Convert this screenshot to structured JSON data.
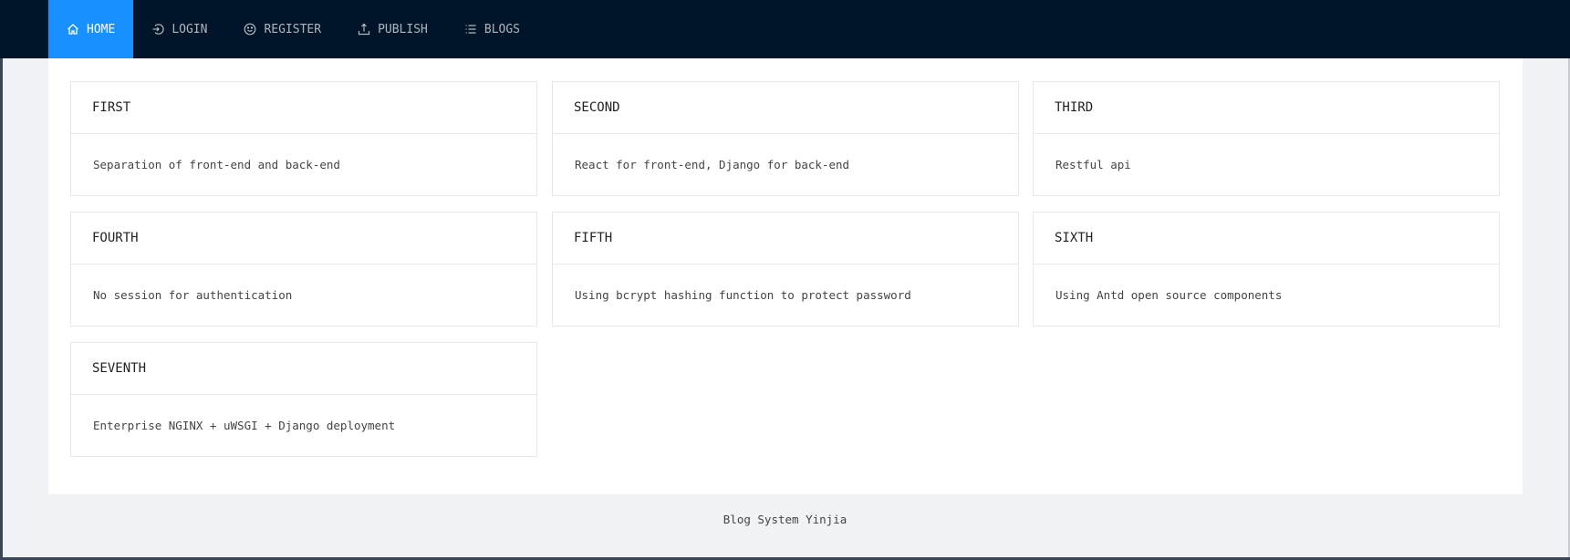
{
  "nav": {
    "items": [
      {
        "label": "HOME",
        "icon": "home-icon",
        "active": true
      },
      {
        "label": "LOGIN",
        "icon": "login-icon",
        "active": false
      },
      {
        "label": "REGISTER",
        "icon": "smile-icon",
        "active": false
      },
      {
        "label": "PUBLISH",
        "icon": "upload-icon",
        "active": false
      },
      {
        "label": "BLOGS",
        "icon": "list-icon",
        "active": false
      }
    ]
  },
  "cards": [
    {
      "title": "FIRST",
      "text": "Separation of front-end and back-end"
    },
    {
      "title": "SECOND",
      "text": "React for front-end, Django for back-end"
    },
    {
      "title": "THIRD",
      "text": "Restful api"
    },
    {
      "title": "FOURTH",
      "text": "No session for authentication"
    },
    {
      "title": "FIFTH",
      "text": "Using bcrypt hashing function to protect password"
    },
    {
      "title": "SIXTH",
      "text": "Using Antd open source components"
    },
    {
      "title": "SEVENTH",
      "text": "Enterprise NGINX + uWSGI + Django deployment"
    }
  ],
  "footer": {
    "text": "Blog System Yinjia"
  },
  "colors": {
    "header_bg": "#001529",
    "active_bg": "#1890ff",
    "page_bg": "#f0f2f5"
  }
}
